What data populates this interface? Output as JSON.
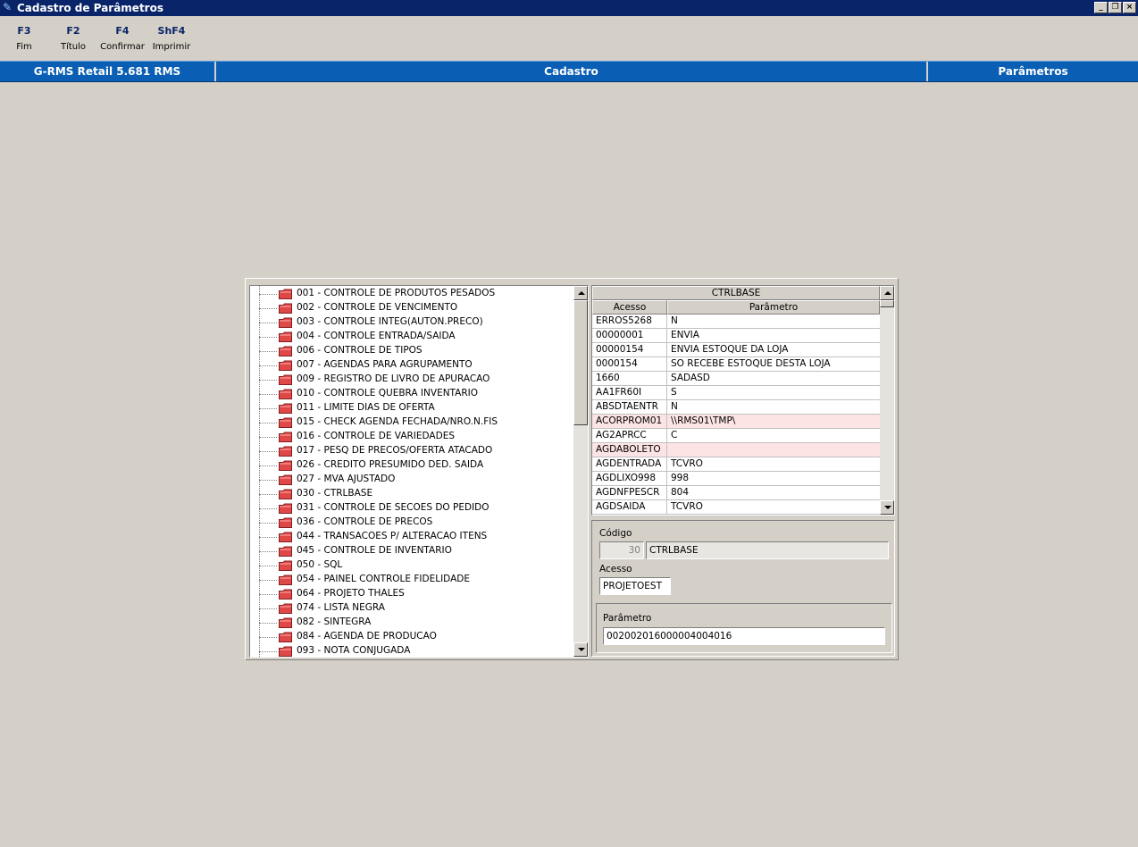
{
  "window": {
    "title": "Cadastro de Parâmetros"
  },
  "toolbar": {
    "keys": [
      {
        "key": "F3",
        "label": "Fim"
      },
      {
        "key": "F2",
        "label": "Título"
      },
      {
        "key": "F4",
        "label": "Confirmar"
      },
      {
        "key": "ShF4",
        "label": "Imprimir"
      }
    ]
  },
  "header": {
    "product": "G-RMS Retail 5.681 RMS",
    "module": "Cadastro",
    "screen": "Parâmetros"
  },
  "tree": {
    "items": [
      "001 - CONTROLE DE PRODUTOS PESADOS",
      "002 - CONTROLE DE VENCIMENTO",
      "003 - CONTROLE INTEG(AUTON.PRECO)",
      "004 - CONTROLE ENTRADA/SAIDA",
      "006 - CONTROLE DE TIPOS",
      "007 - AGENDAS PARA AGRUPAMENTO",
      "009 - REGISTRO DE LIVRO DE APURACAO",
      "010 - CONTROLE QUEBRA INVENTARIO",
      "011 - LIMITE DIAS DE OFERTA",
      "015 - CHECK AGENDA FECHADA/NRO.N.FIS",
      "016 - CONTROLE DE VARIEDADES",
      "017 - PESQ DE PRECOS/OFERTA ATACADO",
      "026 - CREDITO PRESUMIDO DED. SAIDA",
      "027 - MVA AJUSTADO",
      "030 - CTRLBASE",
      "031 - CONTROLE DE SECOES DO PEDIDO",
      "036 - CONTROLE DE PRECOS",
      "044 - TRANSACOES P/ ALTERACAO ITENS",
      "045 - CONTROLE DE INVENTARIO",
      "050 - SQL",
      "054 - PAINEL CONTROLE FIDELIDADE",
      "064 - PROJETO THALES",
      "074 - LISTA NEGRA",
      "082 - SINTEGRA",
      "084 - AGENDA DE PRODUCAO",
      "093 - NOTA CONJUGADA"
    ]
  },
  "grid": {
    "title": "CTRLBASE",
    "columns": [
      "Acesso",
      "Parâmetro"
    ],
    "rows": [
      {
        "acesso": "ERROS5268",
        "parametro": "N",
        "hl": false
      },
      {
        "acesso": "00000001",
        "parametro": "ENVIA",
        "hl": false
      },
      {
        "acesso": "00000154",
        "parametro": "ENVIA ESTOQUE DA LOJA",
        "hl": false
      },
      {
        "acesso": "0000154",
        "parametro": "SO RECEBE ESTOQUE DESTA LOJA",
        "hl": false
      },
      {
        "acesso": "1660",
        "parametro": "SADASD",
        "hl": false
      },
      {
        "acesso": "AA1FR60I",
        "parametro": "S",
        "hl": false
      },
      {
        "acesso": "ABSDTAENTR",
        "parametro": "N",
        "hl": false
      },
      {
        "acesso": "ACORPROM01",
        "parametro": "\\\\RMS01\\TMP\\",
        "hl": true
      },
      {
        "acesso": "AG2APRCC",
        "parametro": "C",
        "hl": false
      },
      {
        "acesso": "AGDABOLETO",
        "parametro": "",
        "hl": true
      },
      {
        "acesso": "AGDENTRADA",
        "parametro": "TCVRO",
        "hl": false
      },
      {
        "acesso": "AGDLIXO998",
        "parametro": "998",
        "hl": false
      },
      {
        "acesso": "AGDNFPESCR",
        "parametro": "804",
        "hl": false
      },
      {
        "acesso": "AGDSAIDA",
        "parametro": "TCVRO",
        "hl": false
      }
    ]
  },
  "form": {
    "codigo_label": "Código",
    "codigo_value": "30",
    "codigo_desc": "CTRLBASE",
    "acesso_label": "Acesso",
    "acesso_value": "PROJETOEST",
    "parametro_label": "Parâmetro",
    "parametro_value": "002002016000004004016"
  },
  "colors": {
    "titlebar": "#0a246a",
    "band": "#0a5fb4",
    "highlight_row": "#fde4e4",
    "folder": "#e04848"
  }
}
